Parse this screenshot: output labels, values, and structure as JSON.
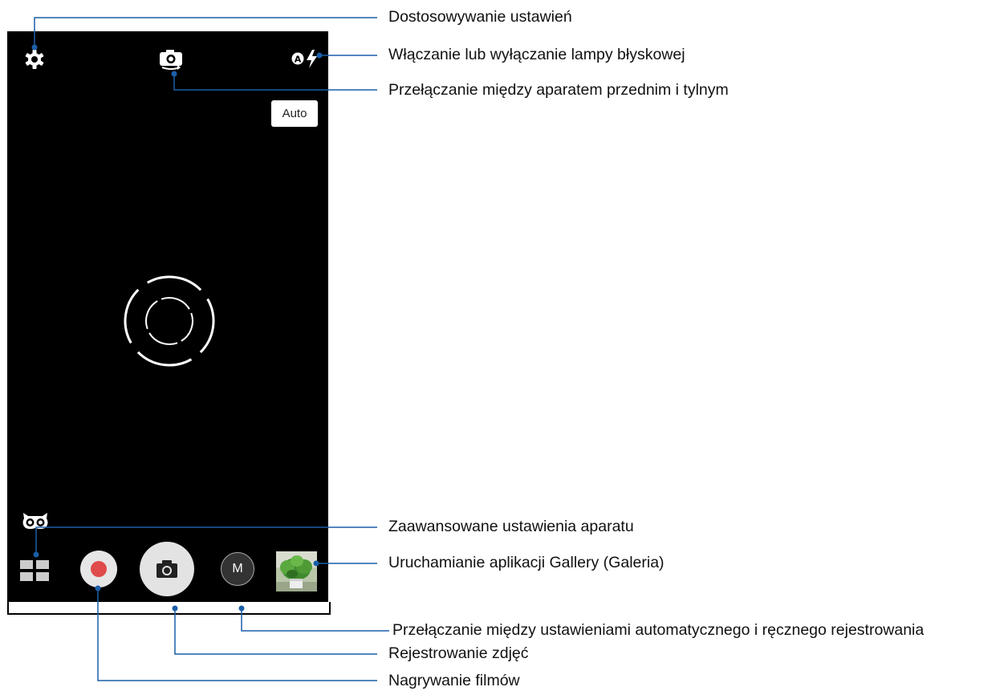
{
  "screen": {
    "auto_label": "Auto",
    "mode_label": "M"
  },
  "callouts": {
    "settings": "Dostosowywanie ustawień",
    "flash": "Włączanie lub wyłączanie lampy błyskowej",
    "switch_camera": "Przełączanie między aparatem przednim i tylnym",
    "advanced": "Zaawansowane ustawienia aparatu",
    "gallery": "Uruchamianie aplikacji Gallery (Galeria)",
    "auto_manual": "Przełączanie między ustawieniami automatycznego i ręcznego rejestrowania",
    "photo": "Rejestrowanie zdjęć",
    "video": "Nagrywanie filmów"
  },
  "colors": {
    "leader_line": "#1a5fa8",
    "record_dot": "#e04a4a",
    "viewfinder_bg": "#000000"
  },
  "icons": [
    "gear-icon",
    "camera-switch-icon",
    "flash-auto-icon",
    "owl-icon",
    "grid-icon",
    "record-icon",
    "camera-icon",
    "manual-mode-icon",
    "gallery-thumbnail"
  ]
}
